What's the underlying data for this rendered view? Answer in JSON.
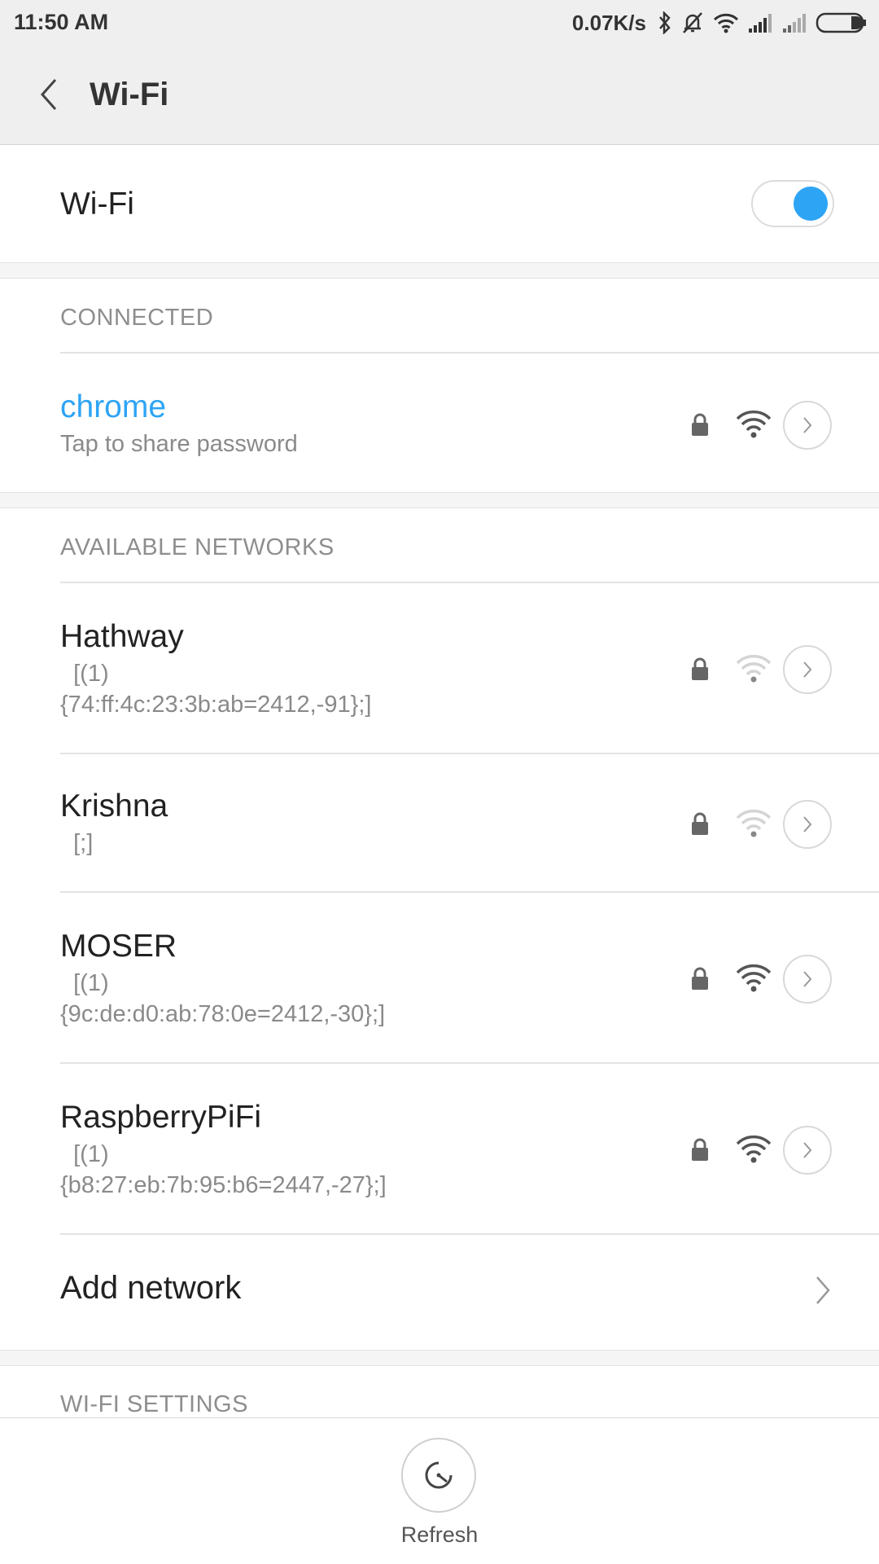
{
  "status_bar": {
    "time": "11:50 AM",
    "speed": "0.07K/s",
    "icons": [
      "bluetooth-icon",
      "mute-icon",
      "wifi-icon",
      "signal-icon",
      "signal-icon",
      "battery-icon"
    ]
  },
  "header": {
    "title": "Wi-Fi",
    "back_icon": "chevron-left-icon"
  },
  "wifi_toggle": {
    "label": "Wi-Fi",
    "on": true
  },
  "connected": {
    "header": "CONNECTED",
    "network": {
      "name": "chrome",
      "subtitle": "Tap to share password",
      "secured": true,
      "signal": "strong"
    }
  },
  "available": {
    "header": "AVAILABLE NETWORKS",
    "networks": [
      {
        "name": "Hathway",
        "subtitle": "  [(1)\n{74:ff:4c:23:3b:ab=2412,-91};]",
        "secured": true,
        "signal": "weak"
      },
      {
        "name": "Krishna",
        "subtitle": "  [;]",
        "secured": true,
        "signal": "weak"
      },
      {
        "name": "MOSER",
        "subtitle": "  [(1)\n{9c:de:d0:ab:78:0e=2412,-30};]",
        "secured": true,
        "signal": "strong"
      },
      {
        "name": "RaspberryPiFi",
        "subtitle": "  [(1)\n{b8:27:eb:7b:95:b6=2447,-27};]",
        "secured": true,
        "signal": "strong"
      }
    ]
  },
  "add_network": {
    "label": "Add network"
  },
  "wifi_settings": {
    "header": "WI-FI SETTINGS"
  },
  "bottom_bar": {
    "refresh_label": "Refresh"
  },
  "colors": {
    "accent": "#2ea4f5",
    "background": "#efefef"
  }
}
